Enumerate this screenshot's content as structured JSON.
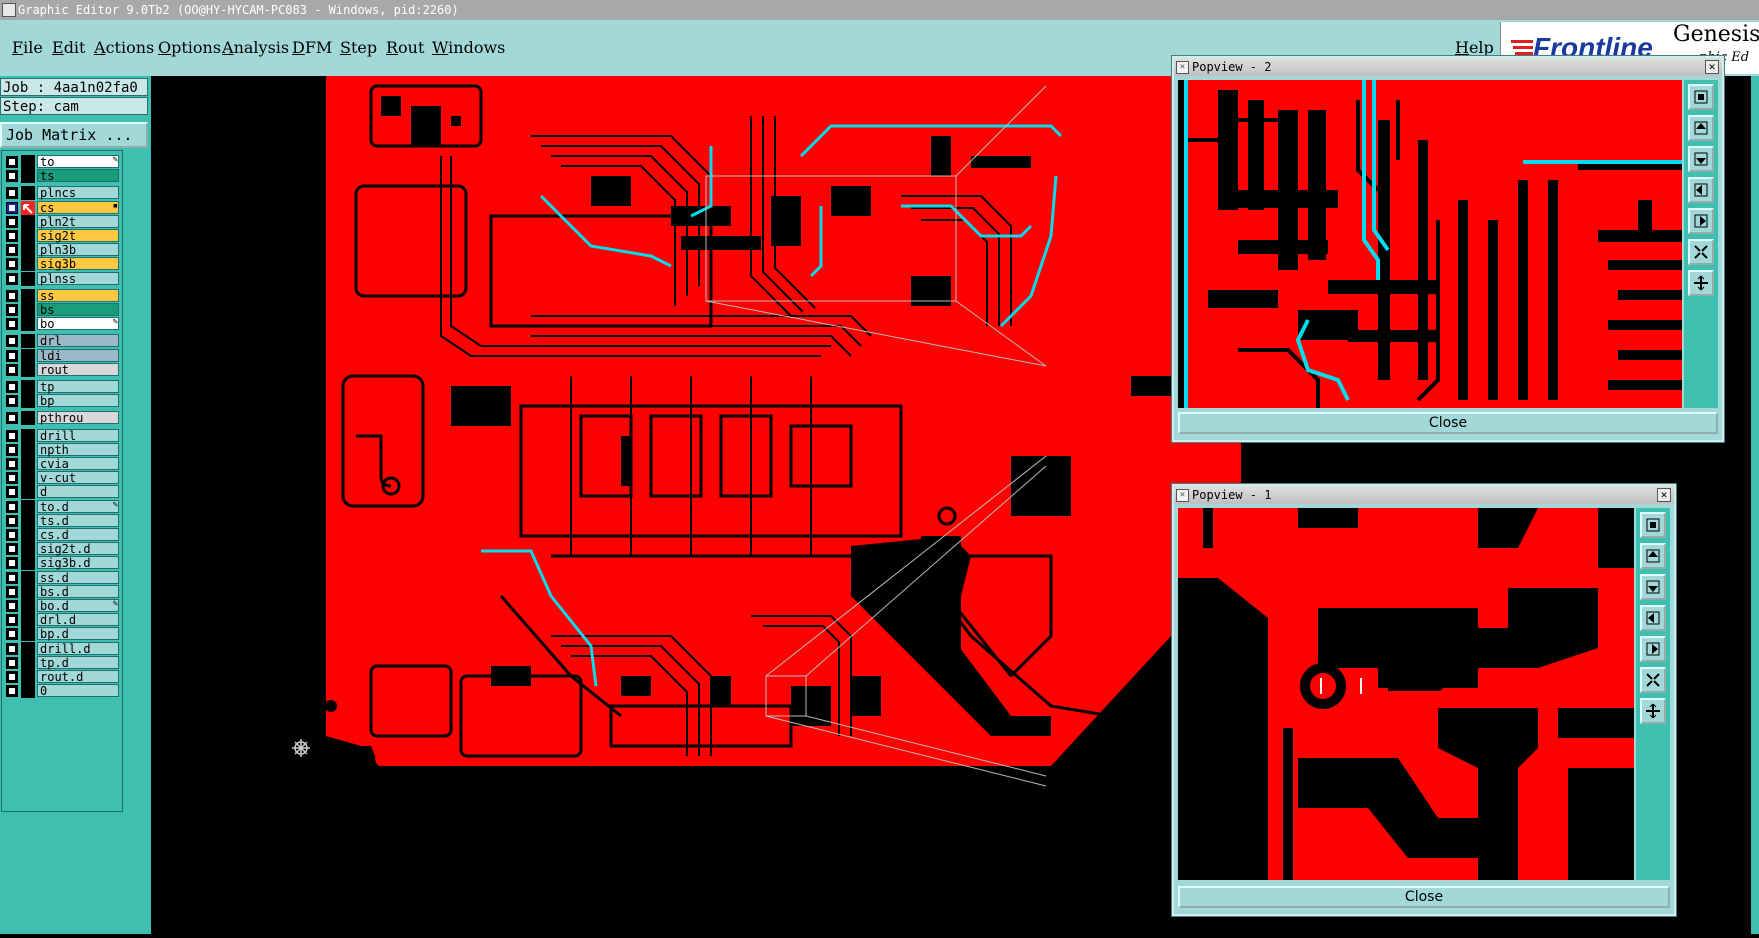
{
  "window": {
    "title": "Graphic Editor 9.0Tb2 (OO@HY-HYCAM-PC083 - Windows, pid:2260)"
  },
  "menu": {
    "items": [
      "File",
      "Edit",
      "Actions",
      "Options",
      "Analysis",
      "DFM",
      "Step",
      "Rout",
      "Windows"
    ],
    "help": "Help"
  },
  "brand": {
    "name": "Frontline",
    "product": "Genesis",
    "sub": "phic Ed"
  },
  "job": {
    "job_line": "Job : 4aa1n02fa0",
    "step_line": "Step: cam",
    "matrix_button": "Job Matrix ..."
  },
  "layers": [
    {
      "name": "to",
      "color": "#ffffff",
      "mark": "✎"
    },
    {
      "name": "ts",
      "color": "#1a9c7a",
      "mark": ""
    },
    {
      "name": "plncs",
      "color": "#a2d8d8",
      "mark": ""
    },
    {
      "name": "cs",
      "color": "#ffc840",
      "mark": "▪",
      "selected": true
    },
    {
      "name": "pln2t",
      "color": "#a2d8d8",
      "mark": ""
    },
    {
      "name": "sig2t",
      "color": "#ffc840",
      "mark": ""
    },
    {
      "name": "pln3b",
      "color": "#a2d8d8",
      "mark": ""
    },
    {
      "name": "sig3b",
      "color": "#ffc840",
      "mark": ""
    },
    {
      "name": "plnss",
      "color": "#a2d8d8",
      "mark": ""
    },
    {
      "name": "ss",
      "color": "#ffc840",
      "mark": ""
    },
    {
      "name": "bs",
      "color": "#1a9c7a",
      "mark": ""
    },
    {
      "name": "bo",
      "color": "#ffffff",
      "mark": "✎"
    },
    {
      "name": "drl",
      "color": "#9cb8c8",
      "mark": ""
    },
    {
      "name": "ldi",
      "color": "#9cb8c8",
      "mark": ""
    },
    {
      "name": "rout",
      "color": "#d8d8d8",
      "mark": ""
    },
    {
      "name": "tp",
      "color": "#a2d8d8",
      "mark": ""
    },
    {
      "name": "bp",
      "color": "#a2d8d8",
      "mark": ""
    },
    {
      "name": "pthrou",
      "color": "#d8d8d8",
      "mark": ""
    },
    {
      "name": "drill",
      "color": "#a2d8d8",
      "mark": ""
    },
    {
      "name": "npth",
      "color": "#a2d8d8",
      "mark": ""
    },
    {
      "name": "cvia",
      "color": "#a2d8d8",
      "mark": ""
    },
    {
      "name": "v-cut",
      "color": "#a2d8d8",
      "mark": ""
    },
    {
      "name": "d",
      "color": "#a2d8d8",
      "mark": ""
    },
    {
      "name": "to.d",
      "color": "#a2d8d8",
      "mark": "✎"
    },
    {
      "name": "ts.d",
      "color": "#a2d8d8",
      "mark": ""
    },
    {
      "name": "cs.d",
      "color": "#a2d8d8",
      "mark": ""
    },
    {
      "name": "sig2t.d",
      "color": "#a2d8d8",
      "mark": ""
    },
    {
      "name": "sig3b.d",
      "color": "#a2d8d8",
      "mark": ""
    },
    {
      "name": "ss.d",
      "color": "#a2d8d8",
      "mark": ""
    },
    {
      "name": "bs.d",
      "color": "#a2d8d8",
      "mark": ""
    },
    {
      "name": "bo.d",
      "color": "#a2d8d8",
      "mark": "✎"
    },
    {
      "name": "drl.d",
      "color": "#a2d8d8",
      "mark": ""
    },
    {
      "name": "bp.d",
      "color": "#a2d8d8",
      "mark": ""
    },
    {
      "name": "drill.d",
      "color": "#a2d8d8",
      "mark": ""
    },
    {
      "name": "tp.d",
      "color": "#a2d8d8",
      "mark": ""
    },
    {
      "name": "rout.d",
      "color": "#a2d8d8",
      "mark": ""
    },
    {
      "name": "0",
      "color": "#a2d8d8",
      "mark": ""
    }
  ],
  "popview2": {
    "title": "Popview - 2",
    "close_label": "Close"
  },
  "popview1": {
    "title": "Popview - 1",
    "close_label": "Close"
  },
  "colors": {
    "board": "#ff0000",
    "trace": "#000000",
    "highlight": "#00ddee",
    "panel": "#3fbfaf",
    "menubar": "#a2d8d8"
  }
}
